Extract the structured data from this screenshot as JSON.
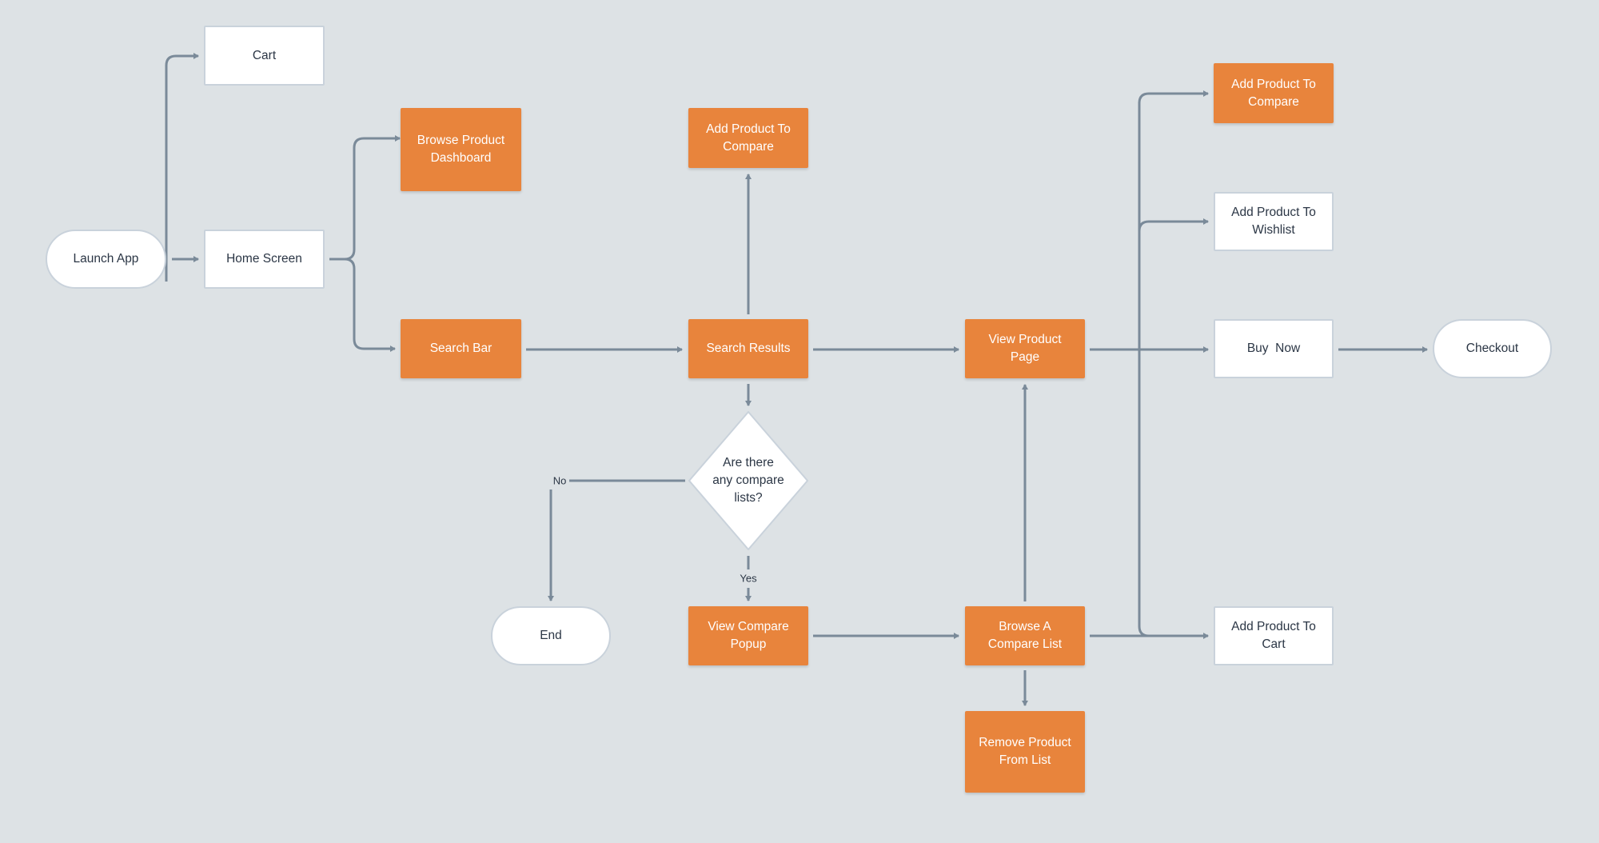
{
  "colors": {
    "background": "#dde2e5",
    "process_orange": "#e8843c",
    "connector": "#7a8a99",
    "text": "#2b3645"
  },
  "nodes": {
    "launch_app": "Launch App",
    "cart": "Cart",
    "home_screen": "Home Screen",
    "browse_dashboard": "Browse Product Dashboard",
    "search_bar": "Search Bar",
    "add_compare_mid": "Add Product To Compare",
    "search_results": "Search Results",
    "decision": "Are there any compare lists?",
    "end": "End",
    "view_compare_popup": "View Compare Popup",
    "view_product_page": "View Product Page",
    "browse_compare_list": "Browse A Compare List",
    "remove_product": "Remove Product From List",
    "add_compare_right": "Add Product To Compare",
    "add_wishlist": "Add Product To Wishlist",
    "buy_now": "Buy  Now",
    "add_cart": "Add Product To Cart",
    "checkout": "Checkout"
  },
  "edge_labels": {
    "no": "No",
    "yes": "Yes"
  }
}
